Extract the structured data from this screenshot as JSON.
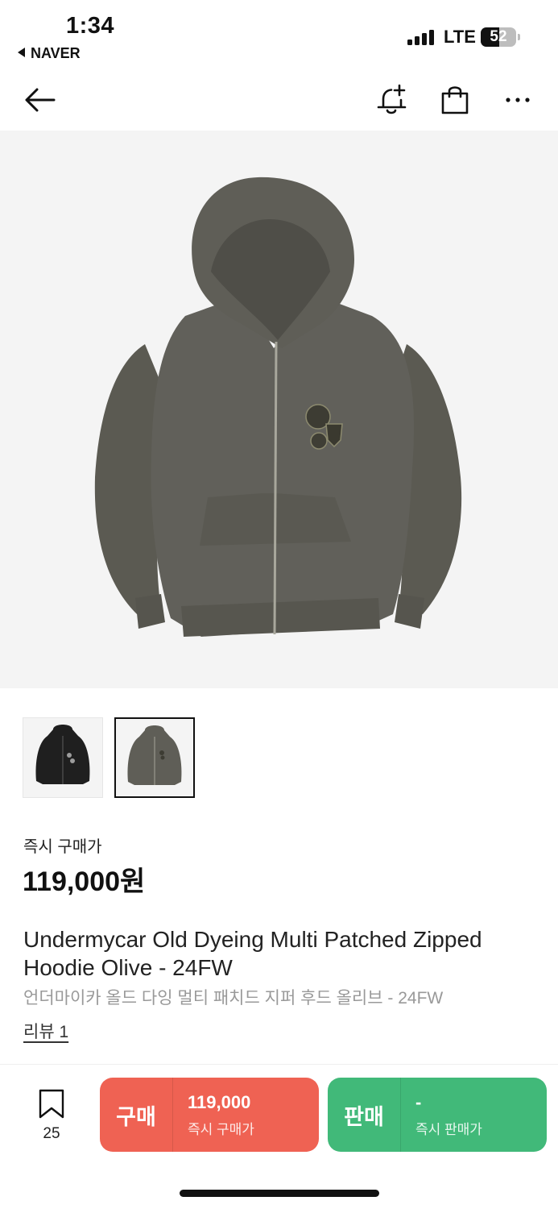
{
  "status_bar": {
    "time": "1:34",
    "back_app": "NAVER",
    "network": "LTE",
    "battery_level": "52",
    "battery_fraction": 0.52
  },
  "nav": {
    "icons": [
      "back-arrow-icon",
      "bell-plus-icon",
      "shopping-bag-icon",
      "more-icon"
    ]
  },
  "gallery": {
    "thumbnails": [
      {
        "name": "black-hoodie",
        "selected": false
      },
      {
        "name": "olive-hoodie",
        "selected": true
      }
    ]
  },
  "product": {
    "price_label": "즉시 구매가",
    "price": "119,000원",
    "title_en": "Undermycar Old Dyeing Multi Patched Zipped Hoodie Olive - 24FW",
    "title_ko": "언더마이카 올드 다잉 멀티 패치드 지퍼 후드 올리브 - 24FW",
    "review_link": "리뷰 1"
  },
  "bottom_bar": {
    "wish_count": "25",
    "buy": {
      "label": "구매",
      "price": "119,000",
      "sub": "즉시 구매가"
    },
    "sell": {
      "label": "판매",
      "price": "-",
      "sub": "즉시 판매가"
    }
  },
  "colors": {
    "buy": "#ef6253",
    "sell": "#41b979",
    "hoodie": "#5e5d55",
    "image_bg": "#f4f4f4"
  }
}
